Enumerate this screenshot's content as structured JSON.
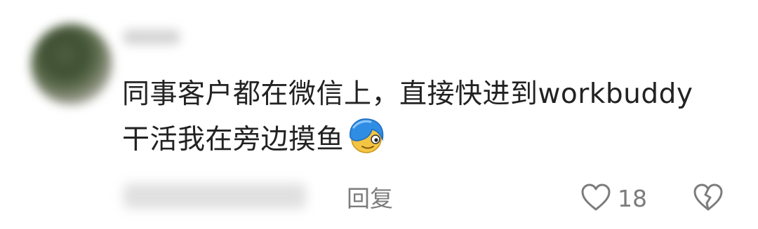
{
  "comment": {
    "text_line1": "同事客户都在微信上，直接快进到workbuddy",
    "text_line2": "干活我在旁边摸鱼",
    "emoji": "blue-hair-peek-emoji",
    "reply_label": "回复",
    "like_count": "18"
  },
  "icons": {
    "like": "heart-icon",
    "dislike": "broken-heart-icon"
  },
  "colors": {
    "text": "#222222",
    "secondary": "#7c7c7c",
    "emoji_hair": "#2f8de4",
    "emoji_face": "#f4c542"
  }
}
